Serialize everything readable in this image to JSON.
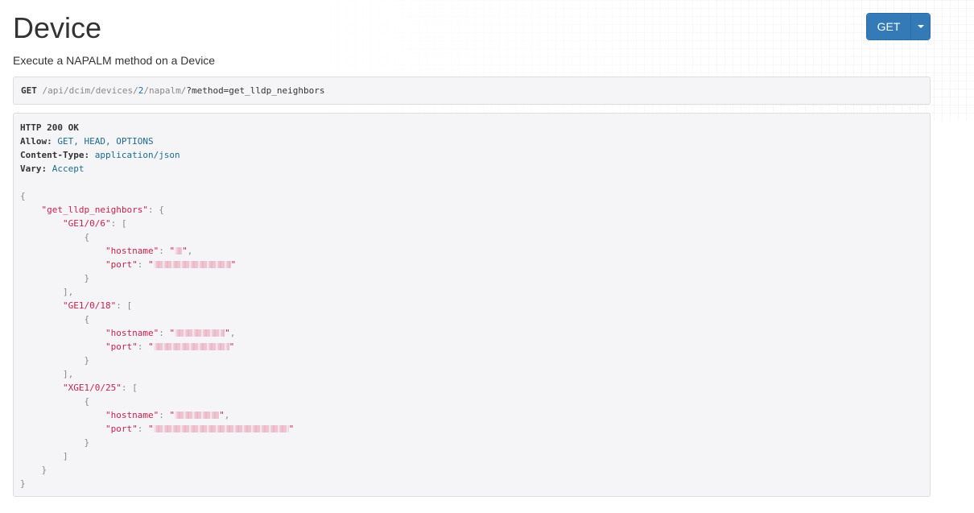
{
  "page": {
    "title": "Device",
    "description": "Execute a NAPALM method on a Device"
  },
  "toolbar": {
    "get_label": "GET",
    "caret_icon": "caret-down-icon"
  },
  "request": {
    "method": "GET",
    "url_segments": [
      {
        "text": "/api/dcim/devices/",
        "kind": "sep"
      },
      {
        "text": "2",
        "kind": "num"
      },
      {
        "text": "/napalm/",
        "kind": "sep"
      },
      {
        "text": "?method=get_lldp_neighbors",
        "kind": "plain"
      }
    ]
  },
  "response": {
    "status": "HTTP 200 OK",
    "headers": [
      {
        "key": "Allow:",
        "value": "GET, HEAD, OPTIONS"
      },
      {
        "key": "Content-Type:",
        "value": "application/json"
      },
      {
        "key": "Vary:",
        "value": "Accept"
      }
    ],
    "root_key": "\"get_lldp_neighbors\"",
    "interfaces": [
      {
        "name": "\"GE1/0/6\"",
        "hostname_field": "\"hostname\"",
        "port_field": "\"port\"",
        "closing": "],"
      },
      {
        "name": "\"GE1/0/18\"",
        "hostname_field": "\"hostname\"",
        "port_field": "\"port\"",
        "closing": "],"
      },
      {
        "name": "\"XGE1/0/25\"",
        "hostname_field": "\"hostname\"",
        "port_field": "\"port\"",
        "closing": "]"
      }
    ]
  },
  "colors": {
    "button": "#337ab7",
    "json_key": "#cc1f4a",
    "header_value": "#1a6b8f",
    "panel_bg": "#f5f5f7"
  }
}
